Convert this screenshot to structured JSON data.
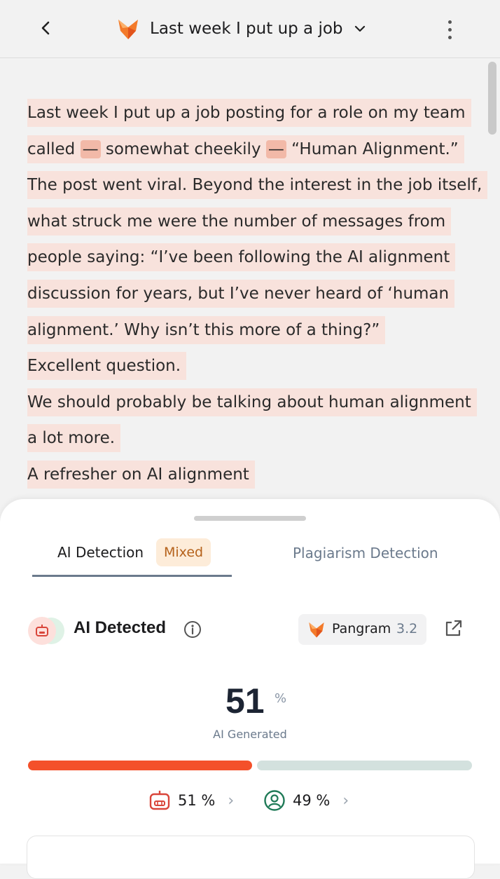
{
  "header": {
    "title": "Last week I put up a job",
    "back_icon": "chevron-left-icon",
    "logo_icon": "fox-logo-icon",
    "dropdown_icon": "chevron-down-icon",
    "menu_icon": "kebab-menu-icon"
  },
  "document": {
    "p1_a": "Last week I put up a job posting for a role on my team called ",
    "dash1": "—",
    "p1_b": " somewhat cheekily ",
    "dash2": "—",
    "p1_c": " “Human Alignment.” The post went viral. Beyond the interest in the job itself, what struck me were the number of messages from people saying: “I’ve been following the AI alignment discussion for years, but I’ve never heard of ‘human alignment.’ Why isn’t this more of a thing?”",
    "p2": "Excellent question.",
    "p3": "We should probably be talking about human alignment a lot more.",
    "p4": "A refresher on AI alignment"
  },
  "sheet": {
    "tabs": {
      "ai_label": "AI Detection",
      "ai_badge": "Mixed",
      "plagiarism_label": "Plagiarism Detection"
    },
    "result": {
      "label": "AI Detected",
      "model_name": "Pangram",
      "model_version": "3.2",
      "ai_percent": "51",
      "percent_symbol": "%",
      "caption": "AI Generated",
      "ai_fraction": 0.51,
      "ai_stat": "51 %",
      "human_stat": "49 %"
    }
  },
  "colors": {
    "accent_orange": "#f4502a",
    "human_bar": "#d3e1de",
    "highlight": "#f8e2dc",
    "mixed_badge_bg": "#fdecd9",
    "mixed_badge_text": "#b5621b",
    "ai_red": "#d9453a",
    "human_green": "#1f7a57"
  }
}
